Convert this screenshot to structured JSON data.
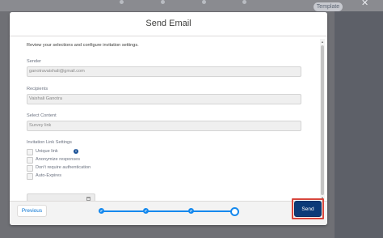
{
  "background": {
    "template_label": "Template",
    "close_glyph": "✕"
  },
  "modal": {
    "title": "Send Email",
    "intro": "Review your selections and configure invitation settings.",
    "fields": {
      "sender": {
        "label": "Sender",
        "value": "ganotravaishali@gmail.com"
      },
      "recipients": {
        "label": "Recipients",
        "value": "Vaishali Ganotra"
      },
      "select_content": {
        "label": "Select Content",
        "value": "Survey link"
      }
    },
    "invitation_settings": {
      "label": "Invitation Link Settings",
      "options": [
        {
          "label": "Unique link",
          "checked": false,
          "info": "i"
        },
        {
          "label": "Anonymize responses",
          "checked": false
        },
        {
          "label": "Don't require authentication",
          "checked": false
        },
        {
          "label": "Auto-Expires",
          "checked": false
        }
      ],
      "expiry_date": {
        "value": "",
        "icon": "calendar-icon"
      }
    },
    "footer": {
      "previous_label": "Previous",
      "send_label": "Send",
      "steps": [
        {
          "state": "complete",
          "glyph": "✔"
        },
        {
          "state": "complete",
          "glyph": "✔"
        },
        {
          "state": "complete",
          "glyph": "✔"
        },
        {
          "state": "current",
          "glyph": ""
        }
      ]
    }
  },
  "colors": {
    "brand_blue": "#0b3a78",
    "progress_blue": "#1589ee",
    "highlight_red": "#d8473d",
    "overlay": "#6f7075"
  }
}
